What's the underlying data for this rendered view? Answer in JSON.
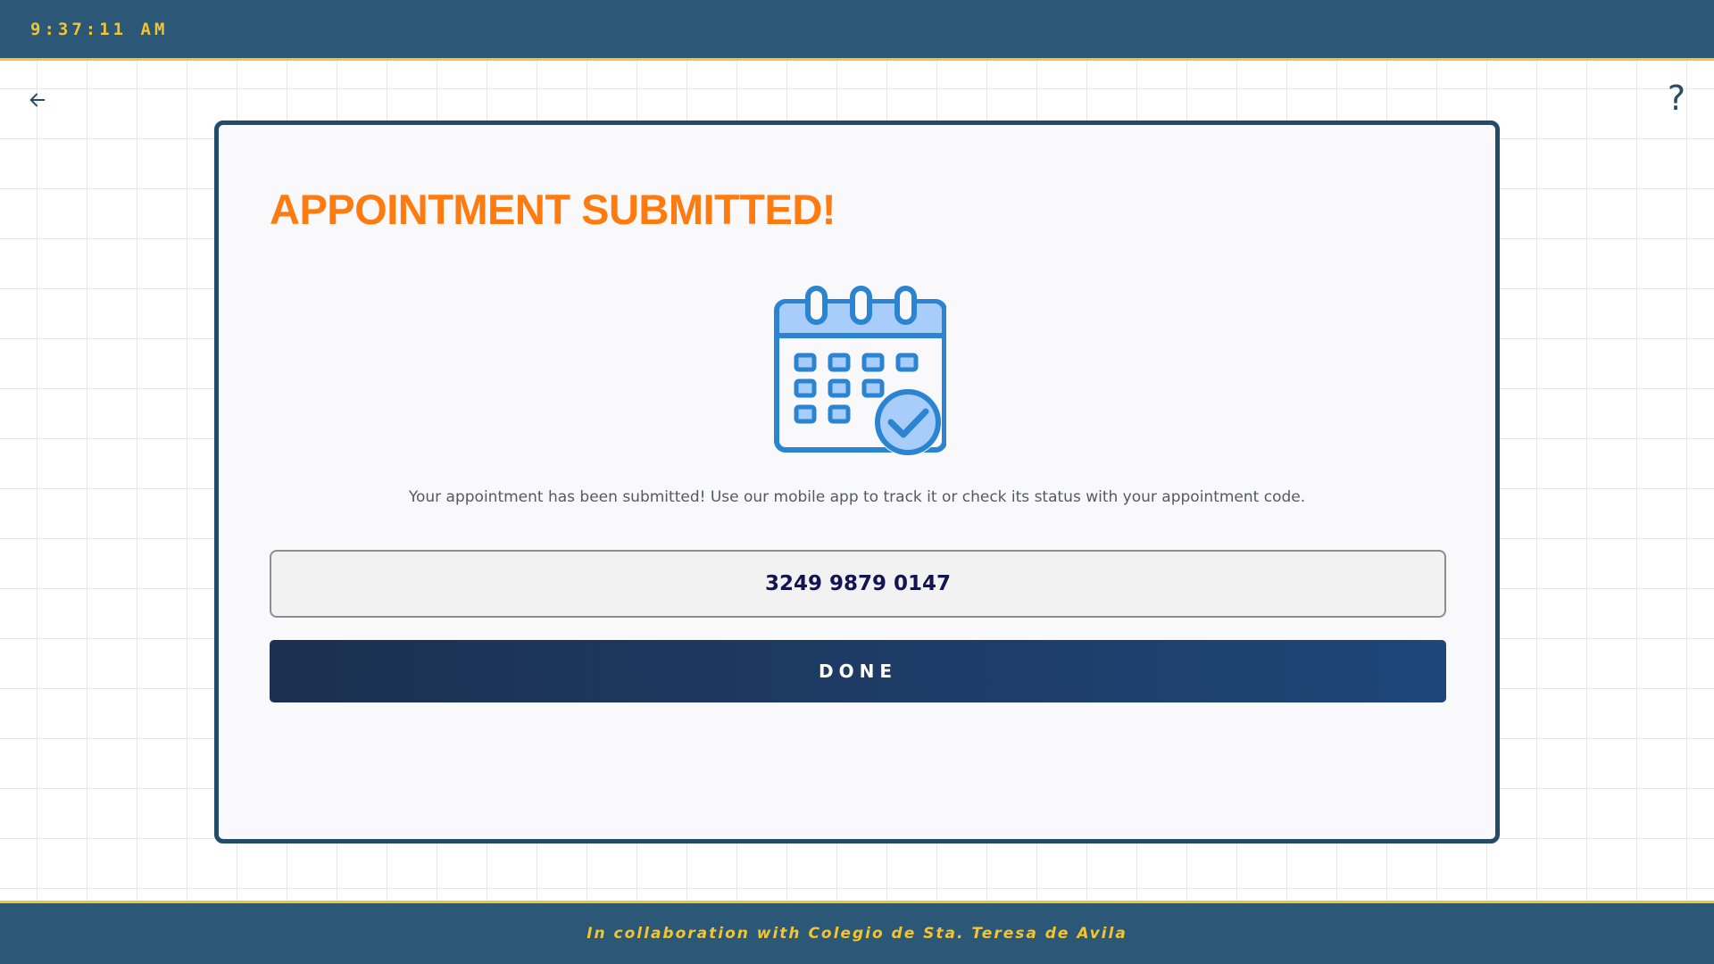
{
  "header": {
    "clock": "9:37:11 AM"
  },
  "nav": {
    "back_icon": "arrow-left-icon",
    "help_label": "?"
  },
  "confirmation": {
    "title": "APPOINTMENT SUBMITTED!",
    "illustration_icon": "calendar-check-icon",
    "message": "Your appointment has been submitted! Use our mobile app to track it or check its status with your appointment code.",
    "appointment_code": "3249 9879 0147",
    "done_label": "DONE"
  },
  "footer": {
    "text": "In collaboration with Colegio de Sta. Teresa de Avila"
  },
  "colors": {
    "header_bg": "#2b5877",
    "accent_yellow": "#f4c430",
    "title_orange": "#ff7b0f",
    "card_border": "#234b68",
    "button_gradient_start": "#1c3050",
    "button_gradient_end": "#1e4679",
    "icon_blue": "#2a84d2",
    "icon_light_blue": "#a8cdfb"
  }
}
